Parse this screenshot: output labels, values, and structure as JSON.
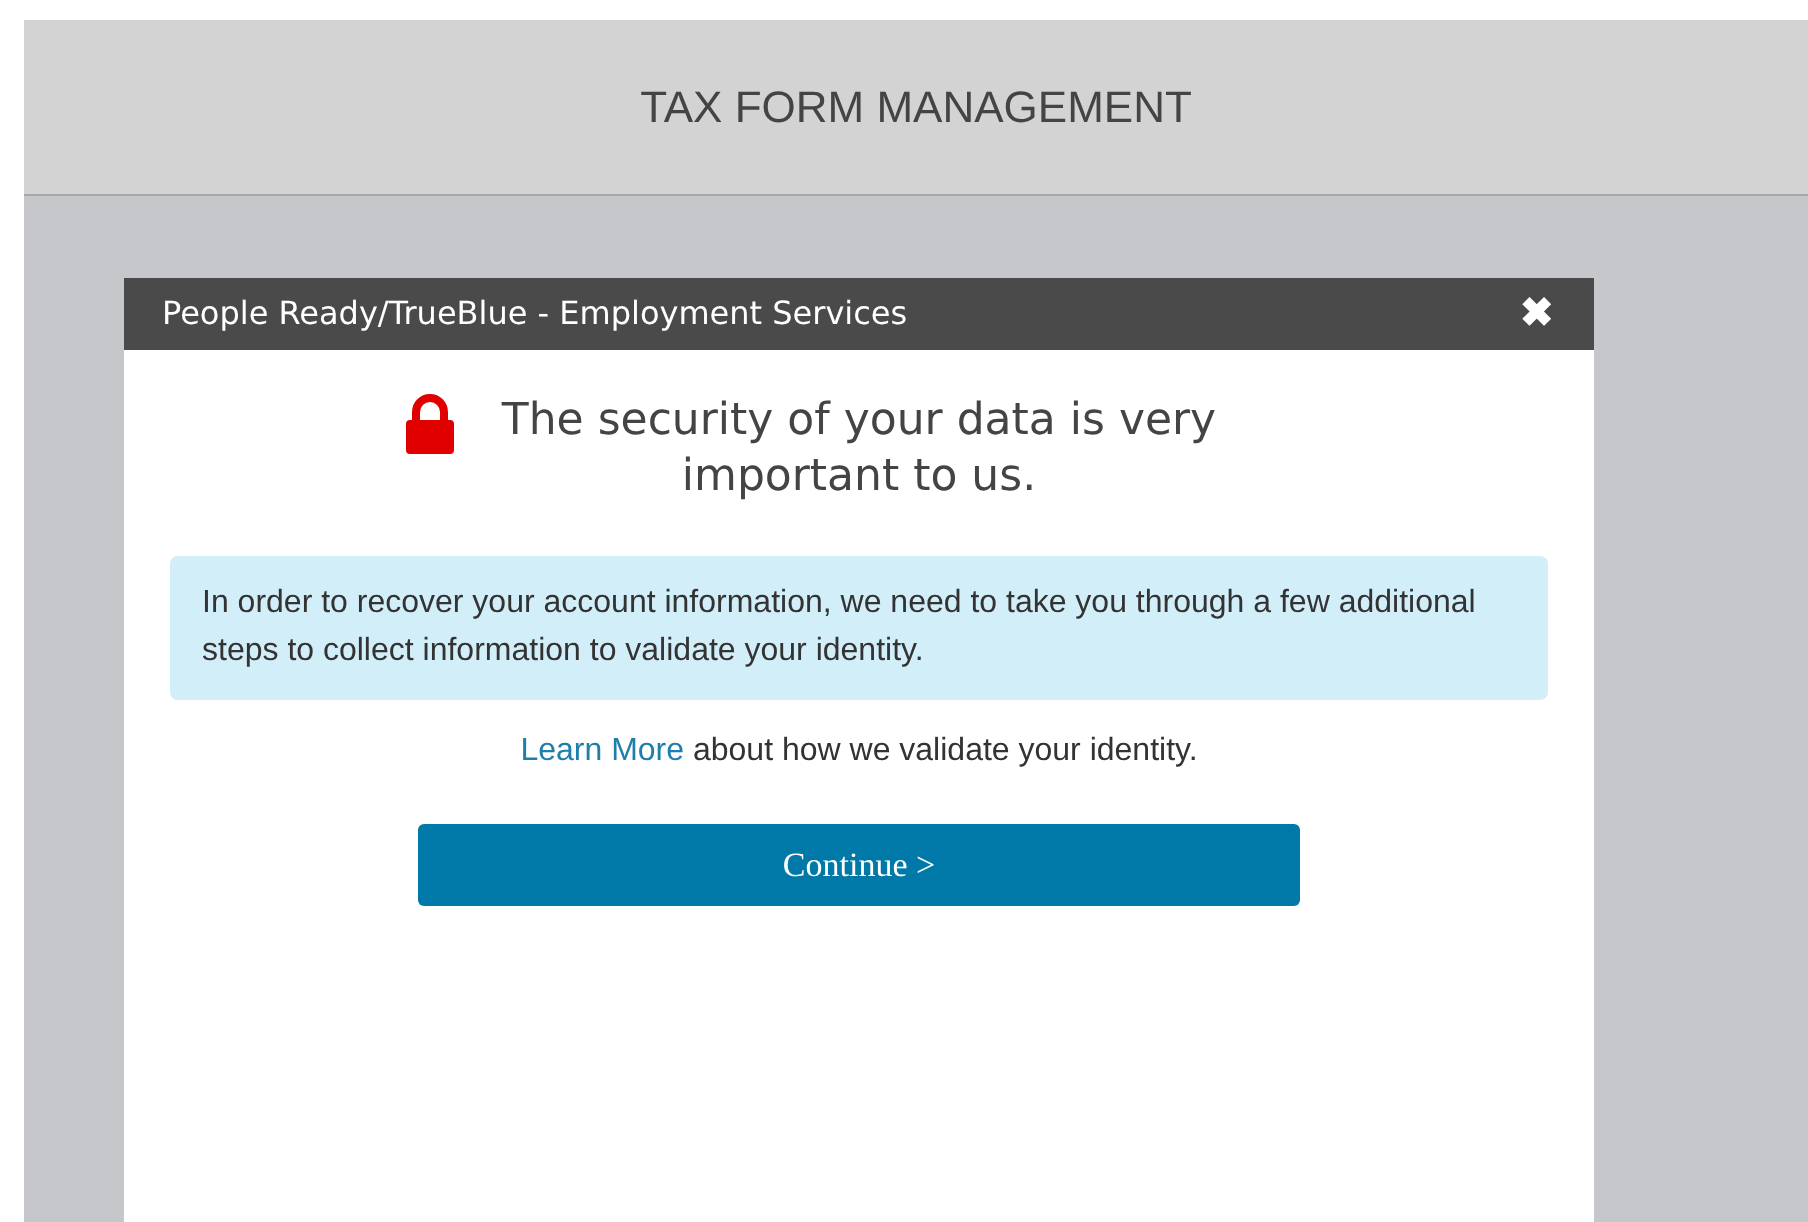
{
  "page": {
    "title": "TAX FORM MANAGEMENT"
  },
  "modal": {
    "title": "People Ready/TrueBlue - Employment Services",
    "close": "✖",
    "heading": "The security of your data is very important to us.",
    "info": "In order to recover your account information, we need to take you through a few additional steps to collect information to validate your identity.",
    "learn_more": {
      "link": "Learn More",
      "text": " about how we validate your identity."
    },
    "button": "Continue >"
  }
}
